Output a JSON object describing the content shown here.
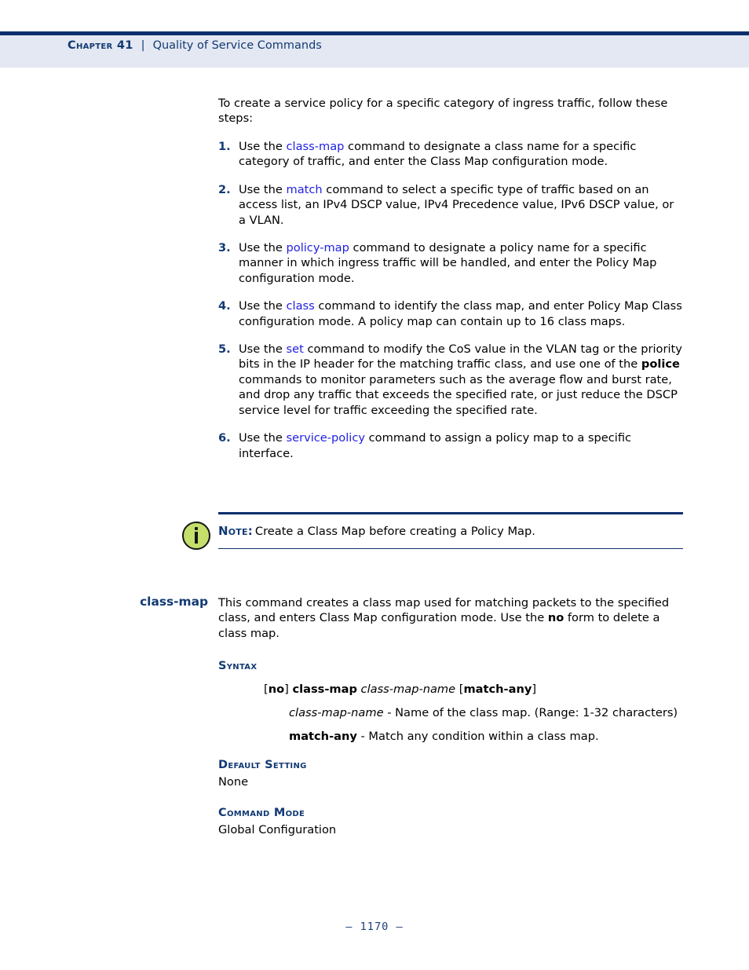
{
  "header": {
    "chapter": "Chapter 41",
    "separator": "|",
    "title": "Quality of Service Commands",
    "band_color": "#e4e8f2",
    "rule_color": "#0d2f6e",
    "text_color": "#123a74"
  },
  "intro": {
    "text": "To create a service policy for a specific category of ingress traffic, follow these steps:"
  },
  "steps": [
    {
      "number": "1.",
      "pre": "Use the ",
      "link": "class-map",
      "post": " command to designate a class name for a specific category of traffic, and enter the Class Map configuration mode."
    },
    {
      "number": "2.",
      "pre": "Use the ",
      "link": "match",
      "post": " command to select a specific type of traffic based on an access list, an IPv4 DSCP value, IPv4 Precedence value, IPv6 DSCP value, or a VLAN."
    },
    {
      "number": "3.",
      "pre": "Use the ",
      "link": "policy-map",
      "post": " command to designate a policy name for a specific manner in which ingress traffic will be handled, and enter the Policy Map configuration mode."
    },
    {
      "number": "4.",
      "pre": "Use the ",
      "link": "class",
      "post": " command to identify the class map, and enter Policy Map Class configuration mode. A policy map can contain up to 16 class maps."
    },
    {
      "number": "5.",
      "pre": "Use the ",
      "link": "set",
      "mid": " command to modify the CoS value in the VLAN tag or the priority bits in the IP header for the matching traffic class, and use one of the ",
      "bold": "police",
      "post": " commands to monitor parameters such as the average flow and burst rate, and drop any traffic that exceeds the specified rate, or just reduce the DSCP service level for traffic exceeding the specified rate."
    },
    {
      "number": "6.",
      "pre": "Use the ",
      "link": "service-policy",
      "post": " command to assign a policy map to a specific interface."
    }
  ],
  "note": {
    "label": "Note:",
    "text": "Create a Class Map before creating a Policy Map.",
    "icon": "info-icon",
    "icon_fill": "#c4e06b",
    "icon_stroke": "#151515"
  },
  "command": {
    "name": "class-map",
    "description_part1": "This command creates a class map used for matching packets to the specified class, and enters Class Map configuration mode. Use the ",
    "description_bold": "no",
    "description_part2": " form to delete a class map.",
    "sections": {
      "syntax_heading": "Syntax",
      "syntax_line": {
        "open_bracket": "[",
        "no": "no",
        "close_bracket": "]",
        "command": "class-map",
        "param_italic": "class-map-name",
        "open_bracket2": "[",
        "keyword": "match-any",
        "close_bracket2": "]"
      },
      "syntax_params": [
        {
          "term": "class-map-name",
          "style": "italic",
          "desc": " - Name of the class map. (Range: 1-32 characters)"
        },
        {
          "term": "match-any",
          "style": "bold",
          "desc": " - Match any condition within a class map."
        }
      ],
      "default_heading": "Default Setting",
      "default_value": "None",
      "mode_heading": "Command Mode",
      "mode_value": "Global Configuration"
    }
  },
  "footer": {
    "page_number": "–  1170  –"
  }
}
